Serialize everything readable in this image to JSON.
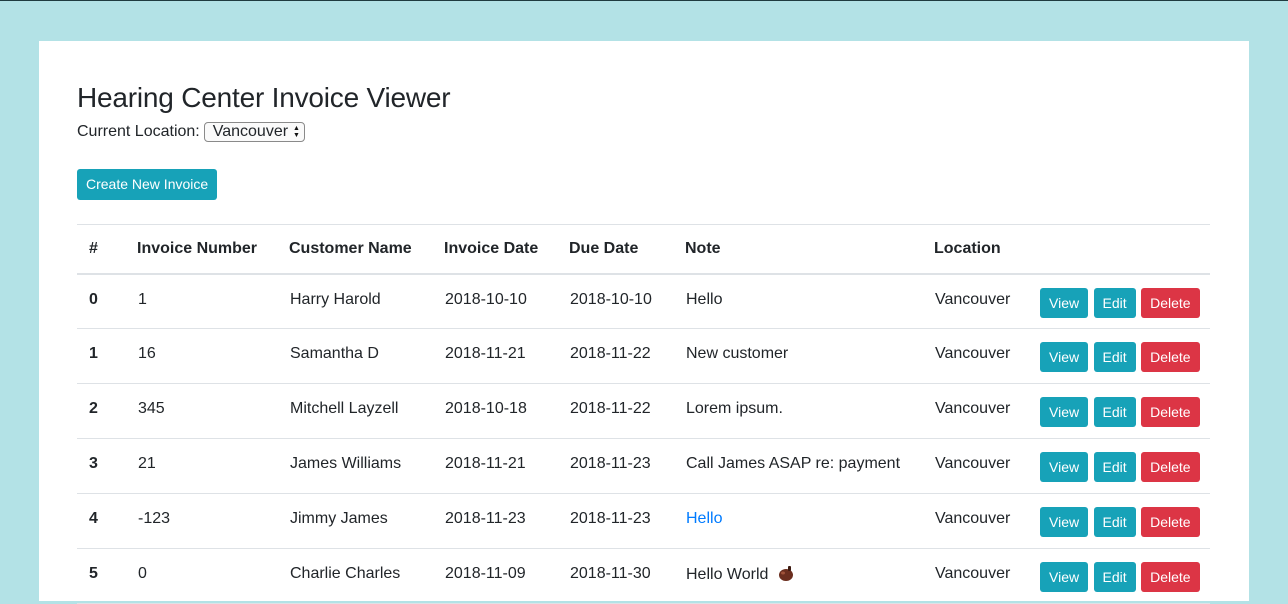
{
  "page": {
    "title": "Hearing Center Invoice Viewer",
    "location_label": "Current Location:",
    "location_selected": "Vancouver",
    "create_button": "Create New Invoice"
  },
  "table": {
    "headers": {
      "index": "#",
      "invoice_number": "Invoice Number",
      "customer_name": "Customer Name",
      "invoice_date": "Invoice Date",
      "due_date": "Due Date",
      "note": "Note",
      "location": "Location"
    },
    "actions": {
      "view": "View",
      "edit": "Edit",
      "delete": "Delete"
    },
    "rows": [
      {
        "index": "0",
        "invoice_number": "1",
        "customer_name": "Harry Harold",
        "invoice_date": "2018-10-10",
        "due_date": "2018-10-10",
        "note": "Hello",
        "location": "Vancouver"
      },
      {
        "index": "1",
        "invoice_number": "16",
        "customer_name": "Samantha D",
        "invoice_date": "2018-11-21",
        "due_date": "2018-11-22",
        "note": "New customer",
        "location": "Vancouver"
      },
      {
        "index": "2",
        "invoice_number": "345",
        "customer_name": "Mitchell Layzell",
        "invoice_date": "2018-10-18",
        "due_date": "2018-11-22",
        "note": "Lorem ipsum.",
        "location": "Vancouver"
      },
      {
        "index": "3",
        "invoice_number": "21",
        "customer_name": "James Williams",
        "invoice_date": "2018-11-21",
        "due_date": "2018-11-23",
        "note": "Call James ASAP re: payment",
        "location": "Vancouver"
      },
      {
        "index": "4",
        "invoice_number": "-123",
        "customer_name": "Jimmy James",
        "invoice_date": "2018-11-23",
        "due_date": "2018-11-23",
        "note": "Hello",
        "location": "Vancouver"
      },
      {
        "index": "5",
        "invoice_number": "0",
        "customer_name": "Charlie Charles",
        "invoice_date": "2018-11-09",
        "due_date": "2018-11-30",
        "note": "Hello World",
        "location": "Vancouver"
      }
    ]
  },
  "colors": {
    "background": "#b3e2e6",
    "info": "#17a2b8",
    "danger": "#dc3545",
    "link": "#007bff"
  }
}
